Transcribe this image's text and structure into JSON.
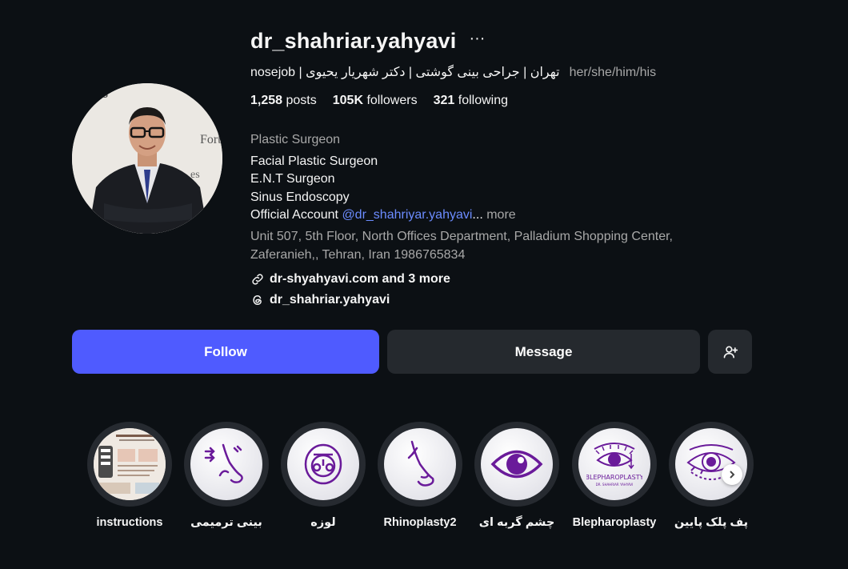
{
  "profile": {
    "username": "dr_shahriar.yahyavi",
    "more_glyph": "···",
    "full_name": "nosejob | تهران | جراحی بینی گوشتی | دکتر شهریار یحیوی",
    "pronouns": "her/she/him/his",
    "stats": [
      {
        "count": "1,258",
        "label": "posts"
      },
      {
        "count": "105K",
        "label": "followers"
      },
      {
        "count": "321",
        "label": "following"
      }
    ],
    "bio": {
      "category": "Plastic Surgeon",
      "lines": [
        "Facial Plastic Surgeon",
        "E.N.T Surgeon",
        "Sinus Endoscopy"
      ],
      "official_prefix": "Official Account ",
      "mention": "@dr_shahriyar.yahyavi",
      "ellipsis": "...",
      "more": " more",
      "address_line1": "Unit 507, 5th Floor, North Offices Department, Palladium Shopping Center,",
      "address_line2": "Zaferanieh,, Tehran, Iran 1986765834"
    },
    "website_link": "dr-shyahyavi.com and 3 more",
    "threads_link": "dr_shahriar.yahyavi"
  },
  "actions": {
    "follow": "Follow",
    "message": "Message",
    "add_user_icon": "person-add-icon"
  },
  "highlights": [
    {
      "label": "instructions",
      "icon": "document-collage"
    },
    {
      "label": "بینی ترمیمی",
      "icon": "nose-arrows-icon"
    },
    {
      "label": "لوزه",
      "icon": "tonsil-mouth-icon"
    },
    {
      "label": "Rhinoplasty2",
      "icon": "nose-profile-icon"
    },
    {
      "label": "چشم گربه ای",
      "icon": "eye-icon"
    },
    {
      "label": "Blepharoplasty",
      "icon": "eyelid-icon"
    },
    {
      "label": "پف پلک پایین",
      "icon": "lower-eyelid-icon"
    }
  ],
  "colors": {
    "background": "#0c1014",
    "follow_button": "#4f5bff",
    "secondary_button": "#25292e",
    "mention": "#6c8cff",
    "highlight_icon": "#6a1b9a"
  }
}
